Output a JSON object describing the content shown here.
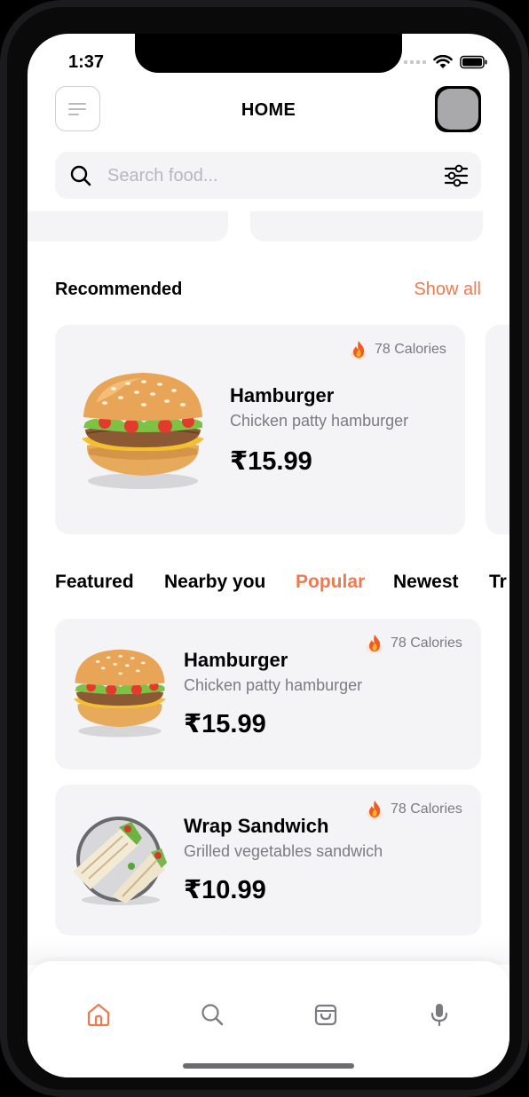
{
  "status": {
    "time": "1:37"
  },
  "header": {
    "title": "HOME"
  },
  "search": {
    "placeholder": "Search food..."
  },
  "recommended": {
    "title": "Recommended",
    "show_all": "Show all",
    "card": {
      "calories": "78 Calories",
      "name": "Hamburger",
      "description": "Chicken patty hamburger",
      "price": "₹15.99"
    }
  },
  "tabs": [
    "Featured",
    "Nearby you",
    "Popular",
    "Newest",
    "Tr"
  ],
  "active_tab": "Popular",
  "list": [
    {
      "calories": "78 Calories",
      "name": "Hamburger",
      "description": "Chicken patty hamburger",
      "price": "₹15.99",
      "image": "burger-image"
    },
    {
      "calories": "78 Calories",
      "name": "Wrap Sandwich",
      "description": "Grilled vegetables sandwich",
      "price": "₹10.99",
      "image": "wrap-image"
    }
  ],
  "tabbar": {
    "items": [
      "home-icon",
      "search-icon",
      "shopping-bag-icon",
      "microphone-icon"
    ],
    "active": "home-icon"
  },
  "colors": {
    "accent": "#ef7a4f",
    "card_bg": "#f4f4f6",
    "text_muted": "#7b7b83"
  }
}
